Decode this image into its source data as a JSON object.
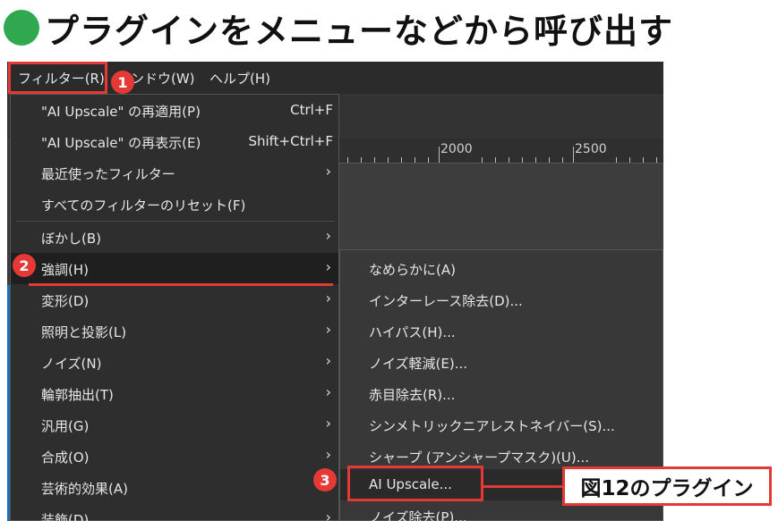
{
  "title": {
    "text": "プラグインをメニューなどから呼び出す",
    "dot_color": "#2fa84f"
  },
  "menubar": {
    "filter": "フィルター(R)",
    "window": "ンドウ(W)",
    "help": "ヘルプ(H)"
  },
  "ruler": {
    "labels": [
      "2000",
      "2500"
    ]
  },
  "filter_menu": {
    "items": [
      {
        "label": "\"AI Upscale\" の再適用(P)",
        "shortcut": "Ctrl+F"
      },
      {
        "label": "\"AI Upscale\" の再表示(E)",
        "shortcut": "Shift+Ctrl+F"
      },
      {
        "label": "最近使ったフィルター",
        "arrow": "›"
      },
      {
        "label": "すべてのフィルターのリセット(F)"
      },
      {
        "label": "ぼかし(B)",
        "arrow": "›"
      },
      {
        "label": "強調(H)",
        "arrow": "›"
      },
      {
        "label": "変形(D)",
        "arrow": "›"
      },
      {
        "label": "照明と投影(L)",
        "arrow": "›"
      },
      {
        "label": "ノイズ(N)",
        "arrow": "›"
      },
      {
        "label": "輪郭抽出(T)",
        "arrow": "›"
      },
      {
        "label": "汎用(G)",
        "arrow": "›"
      },
      {
        "label": "合成(O)",
        "arrow": "›"
      },
      {
        "label": "芸術的効果(A)",
        "arrow": "›"
      },
      {
        "label": "装飾(D)",
        "arrow": "›"
      }
    ]
  },
  "enhance_submenu": {
    "items": [
      {
        "label": "なめらかに(A)"
      },
      {
        "label": "インターレース除去(D)..."
      },
      {
        "label": "ハイパス(H)..."
      },
      {
        "label": "ノイズ軽減(E)..."
      },
      {
        "label": "赤目除去(R)..."
      },
      {
        "label": "シンメトリックニアレストネイバー(S)..."
      },
      {
        "label": "シャープ (アンシャープマスク)(U)..."
      },
      {
        "label": "AI Upscale..."
      },
      {
        "label": "ノイズ除去(P)..."
      }
    ]
  },
  "badges": {
    "one": "1",
    "two": "2",
    "three": "3"
  },
  "callout": {
    "text": "図12のプラグイン"
  },
  "colors": {
    "accent": "#e53935",
    "menu_bg": "#2e2e2e",
    "submenu_bg": "#383838"
  }
}
